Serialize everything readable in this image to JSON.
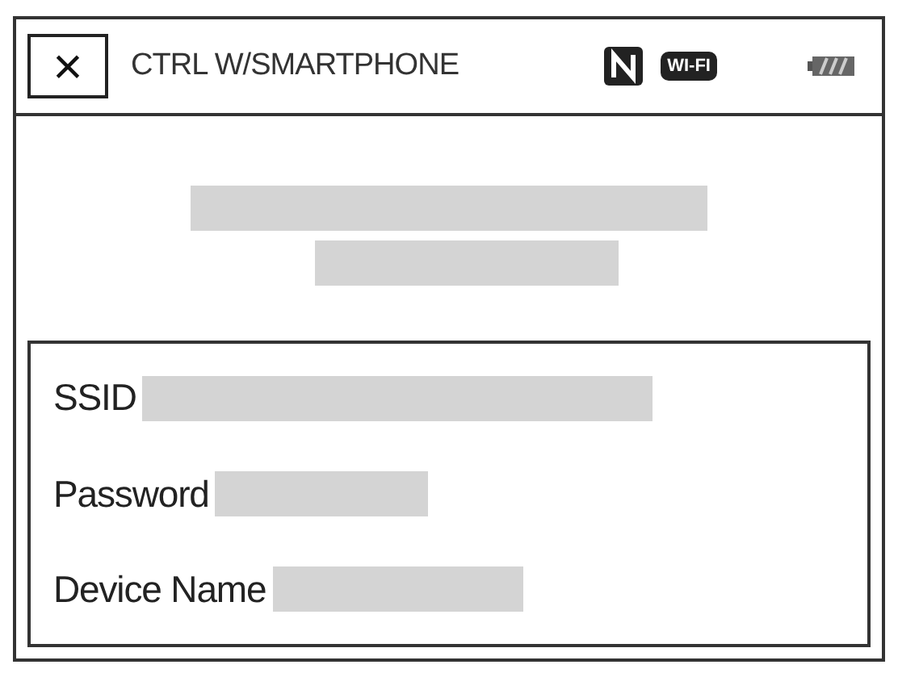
{
  "header": {
    "close": "×",
    "title": "CTRL W/SMARTPHONE",
    "wifi_badge": "WI-FI"
  },
  "fields": [
    {
      "label": "SSID"
    },
    {
      "label": "Password"
    },
    {
      "label": "Device Name"
    }
  ]
}
